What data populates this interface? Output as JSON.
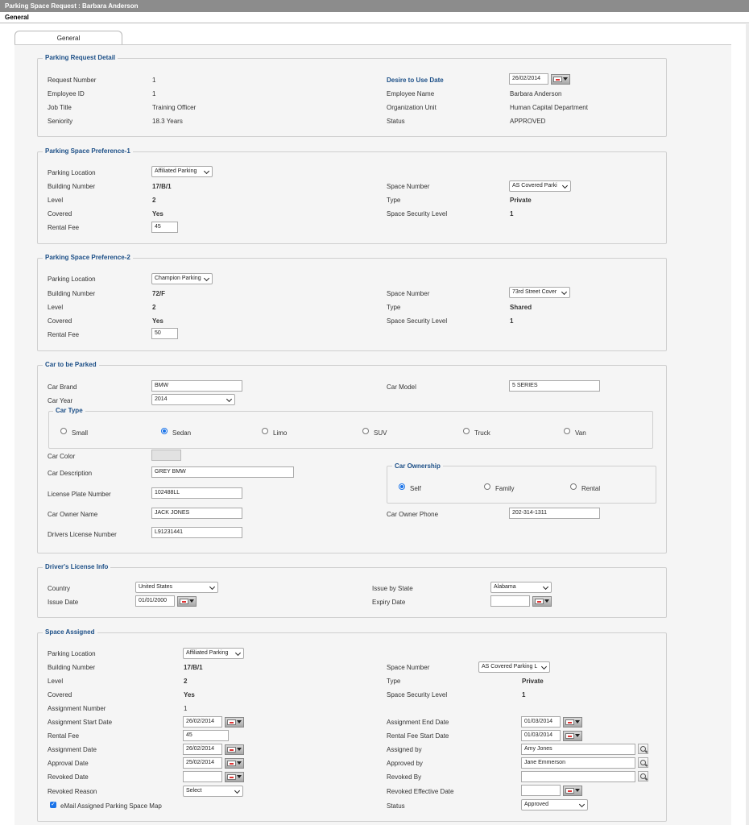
{
  "window": {
    "title": "Parking Space Request  :  Barbara Anderson",
    "section": "General"
  },
  "tabs": [
    {
      "label": "General"
    }
  ],
  "request_detail": {
    "legend": "Parking Request Detail",
    "request_number_label": "Request Number",
    "request_number": "1",
    "employee_id_label": "Employee ID",
    "employee_id": "1",
    "job_title_label": "Job Title",
    "job_title": "Training Officer",
    "seniority_label": "Seniority",
    "seniority": "18.3 Years",
    "desire_date_label": "Desire to Use Date",
    "desire_date": "26/02/2014",
    "employee_name_label": "Employee Name",
    "employee_name": "Barbara Anderson",
    "org_unit_label": "Organization Unit",
    "org_unit": "Human Capital Department",
    "status_label": "Status",
    "status": "APPROVED"
  },
  "pref1": {
    "legend": "Parking Space Preference-1",
    "parking_location_label": "Parking Location",
    "parking_location": "Affiliated Parking",
    "building_number_label": "Building Number",
    "building_number": "17/B/1",
    "level_label": "Level",
    "level": "2",
    "covered_label": "Covered",
    "covered": "Yes",
    "rental_fee_label": "Rental Fee",
    "rental_fee": "45",
    "space_number_label": "Space Number",
    "space_number": "AS Covered Parki",
    "type_label": "Type",
    "type": "Private",
    "security_label": "Space Security Level",
    "security": "1"
  },
  "pref2": {
    "legend": "Parking Space Preference-2",
    "parking_location_label": "Parking Location",
    "parking_location": "Champion Parking",
    "building_number_label": "Building Number",
    "building_number": "72/F",
    "level_label": "Level",
    "level": "2",
    "covered_label": "Covered",
    "covered": "Yes",
    "rental_fee_label": "Rental Fee",
    "rental_fee": "50",
    "space_number_label": "Space Number",
    "space_number": "73rd Street Cover",
    "type_label": "Type",
    "type": "Shared",
    "security_label": "Space Security Level",
    "security": "1"
  },
  "car": {
    "legend": "Car to be Parked",
    "brand_label": "Car Brand",
    "brand": "BMW",
    "model_label": "Car Model",
    "model": "5 SERIES",
    "year_label": "Car Year",
    "year": "2014",
    "type_legend": "Car Type",
    "types": [
      "Small",
      "Sedan",
      "Limo",
      "SUV",
      "Truck",
      "Van"
    ],
    "selected_type": "Sedan",
    "color_label": "Car Color",
    "color_value": "#e2e2e2",
    "description_label": "Car Description",
    "description": "GREY BMW",
    "plate_label": "License Plate Number",
    "plate": "102488LL",
    "owner_name_label": "Car Owner Name",
    "owner_name": "JACK JONES",
    "drivers_license_label": "Drivers License Number",
    "drivers_license": "L91231441",
    "ownership_legend": "Car Ownership",
    "ownership_options": [
      "Self",
      "Family",
      "Rental"
    ],
    "selected_ownership": "Self",
    "owner_phone_label": "Car Owner Phone",
    "owner_phone": "202-314-1311"
  },
  "license": {
    "legend": "Driver's License Info",
    "country_label": "Country",
    "country": "United States",
    "issue_date_label": "Issue Date",
    "issue_date": "01/01/2000",
    "issue_state_label": "Issue by State",
    "issue_state": "Alabama",
    "expiry_label": "Expiry Date",
    "expiry": ""
  },
  "assigned": {
    "legend": "Space Assigned",
    "parking_location_label": "Parking Location",
    "parking_location": "Affiliated Parking",
    "building_number_label": "Building Number",
    "building_number": "17/B/1",
    "level_label": "Level",
    "level": "2",
    "covered_label": "Covered",
    "covered": "Yes",
    "assignment_number_label": "Assignment Number",
    "assignment_number": "1",
    "start_date_label": "Assignment Start Date",
    "start_date": "26/02/2014",
    "rental_fee_label": "Rental Fee",
    "rental_fee": "45",
    "assignment_date_label": "Assignment Date",
    "assignment_date": "26/02/2014",
    "approval_date_label": "Approval Date",
    "approval_date": "25/02/2014",
    "revoked_date_label": "Revoked Date",
    "revoked_date": "",
    "revoked_reason_label": "Revoked Reason",
    "revoked_reason": "Select",
    "email_map_label": "eMail Assigned Parking Space Map",
    "email_map_checked": true,
    "space_number_label": "Space Number",
    "space_number": "AS Covered Parking L",
    "type_label": "Type",
    "type": "Private",
    "security_label": "Space Security Level",
    "security": "1",
    "end_date_label": "Assignment End Date",
    "end_date": "01/03/2014",
    "fee_start_label": "Rental Fee Start Date",
    "fee_start": "01/03/2014",
    "assigned_by_label": "Assigned by",
    "assigned_by": "Amy Jones",
    "approved_by_label": "Approved by",
    "approved_by": "Jane Emmerson",
    "revoked_by_label": "Revoked By",
    "revoked_by": "",
    "revoked_effective_label": "Revoked Effective Date",
    "revoked_effective": "",
    "status_label": "Status",
    "status": "Approved"
  }
}
